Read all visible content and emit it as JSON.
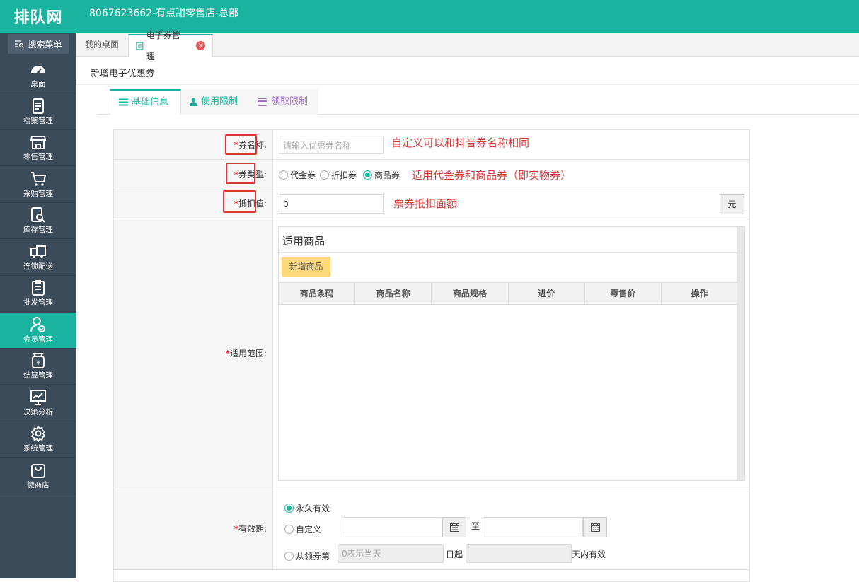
{
  "app": {
    "logo_text": "排队网",
    "store_title": "8067623662-有点甜零售店-总部"
  },
  "sidebar": {
    "search_label": "搜索菜单",
    "items": [
      {
        "label": "桌面",
        "icon": "dashboard-icon"
      },
      {
        "label": "档案管理",
        "icon": "archive-icon"
      },
      {
        "label": "零售管理",
        "icon": "store-icon"
      },
      {
        "label": "采购管理",
        "icon": "cart-icon"
      },
      {
        "label": "库存管理",
        "icon": "inventory-search-icon"
      },
      {
        "label": "连锁配送",
        "icon": "truck-icon"
      },
      {
        "label": "批发管理",
        "icon": "clipboard-icon"
      },
      {
        "label": "会员管理",
        "icon": "member-icon"
      },
      {
        "label": "结算管理",
        "icon": "yen-icon"
      },
      {
        "label": "决策分析",
        "icon": "chart-icon"
      },
      {
        "label": "系统管理",
        "icon": "gear-icon"
      },
      {
        "label": "微商店",
        "icon": "bag-icon"
      }
    ],
    "active_index": 7
  },
  "tabs": {
    "desktop": "我的桌面",
    "coupon": "电子券管理"
  },
  "page": {
    "title": "新增电子优惠券",
    "subtabs": {
      "basic": "基础信息",
      "usage": "使用限制",
      "receive": "领取限制"
    }
  },
  "form": {
    "name": {
      "label": "券名称:",
      "placeholder": "请输入优惠券名称",
      "annotation": "自定义可以和抖音券名称相同"
    },
    "type": {
      "label": "券类型:",
      "options": [
        "代金券",
        "折扣券",
        "商品券"
      ],
      "selected": "商品券",
      "annotation": "适用代金券和商品券（即实物券）"
    },
    "deduct": {
      "label": "抵扣值:",
      "value": "0",
      "unit": "元",
      "annotation": "票券抵扣面额"
    },
    "scope": {
      "label": "适用范围:",
      "panel_title": "适用商品",
      "add_button": "新增商品",
      "columns": [
        "商品条码",
        "商品名称",
        "商品规格",
        "进价",
        "零售价",
        "操作"
      ]
    },
    "validity": {
      "label": "有效期:",
      "permanent": "永久有效",
      "custom": "自定义",
      "to": "至",
      "from_receive_prefix": "从领券第",
      "from_receive_placeholder": "0表示当天",
      "day_from": "日起",
      "days_valid": "天内有效",
      "selected": "永久有效"
    }
  },
  "colors": {
    "accent": "#1ab39f",
    "sidebar": "#3c4b5a",
    "annotation": "#d9383a"
  }
}
